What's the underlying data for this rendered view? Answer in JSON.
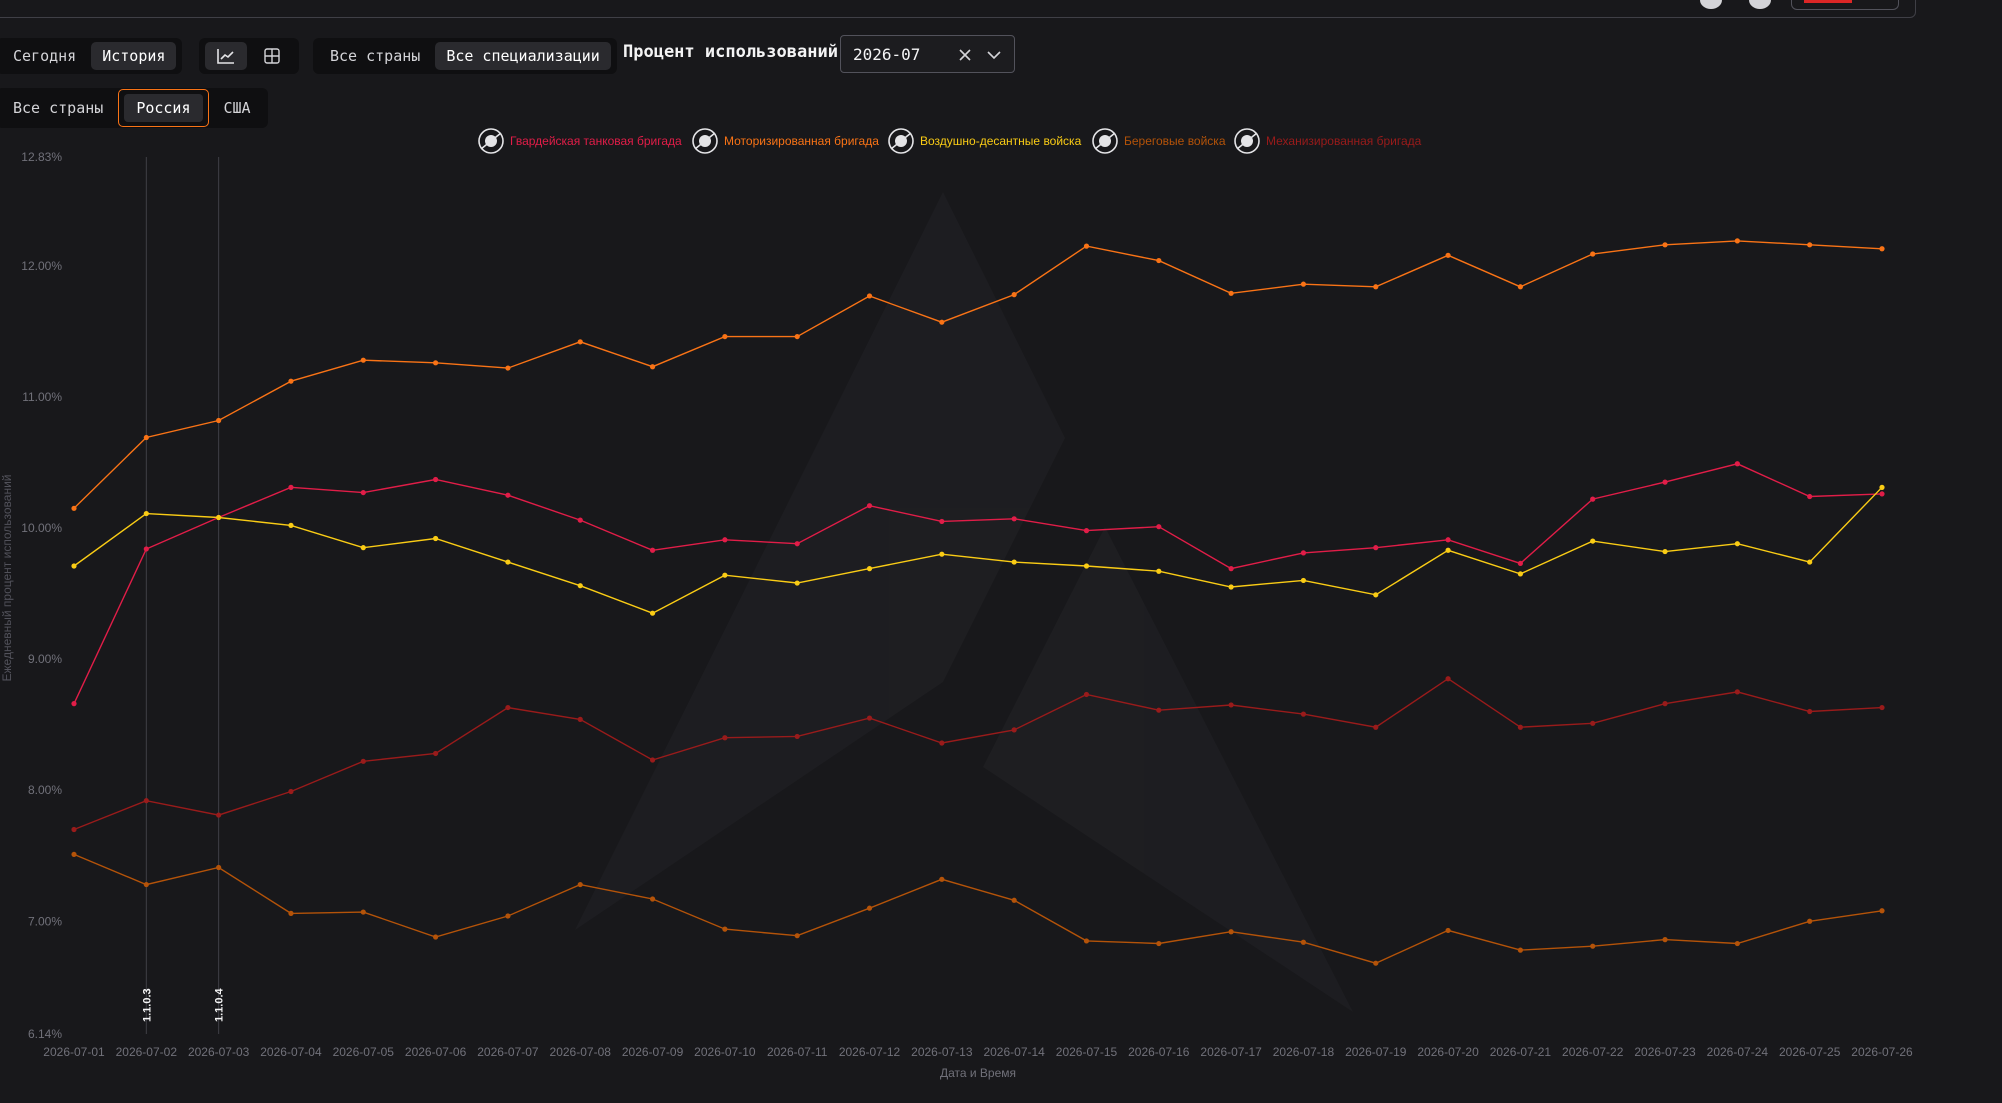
{
  "toolbar": {
    "range_tabs": [
      {
        "label": "Сегодня",
        "active": false
      },
      {
        "label": "История",
        "active": true
      }
    ],
    "view_icons": [
      {
        "icon": "line-chart-icon",
        "active": true
      },
      {
        "icon": "grid-table-icon",
        "active": false
      }
    ],
    "scope_tabs": [
      {
        "label": "Все страны",
        "active": false
      },
      {
        "label": "Все специализации",
        "active": true
      }
    ],
    "metric_label": "Процент использований",
    "month_value": "2026-07",
    "country_tabs": [
      {
        "label": "Все страны",
        "active": false
      },
      {
        "label": "Россия",
        "active": true
      },
      {
        "label": "США",
        "active": false
      }
    ]
  },
  "colors": {
    "background": "#18181b",
    "accent": "#f97316"
  },
  "chart_data": {
    "type": "line",
    "xlabel": "Дата и Время",
    "ylabel": "Ежедневный процент использований",
    "ylim": [
      6.14,
      12.83
    ],
    "y_ticks": [
      "12.83%",
      "12.00%",
      "11.00%",
      "10.00%",
      "9.00%",
      "8.00%",
      "7.00%",
      "6.14%"
    ],
    "y_tick_values": [
      12.83,
      12.0,
      11.0,
      10.0,
      9.0,
      8.0,
      7.0,
      6.14
    ],
    "legend_position": "top-center",
    "grid": false,
    "x": [
      "2026-07-01",
      "2026-07-02",
      "2026-07-03",
      "2026-07-04",
      "2026-07-05",
      "2026-07-06",
      "2026-07-07",
      "2026-07-08",
      "2026-07-09",
      "2026-07-10",
      "2026-07-11",
      "2026-07-12",
      "2026-07-13",
      "2026-07-14",
      "2026-07-15",
      "2026-07-16",
      "2026-07-17",
      "2026-07-18",
      "2026-07-19",
      "2026-07-20",
      "2026-07-21",
      "2026-07-22",
      "2026-07-23",
      "2026-07-24",
      "2026-07-25",
      "2026-07-26"
    ],
    "series": [
      {
        "name": "Гвардейская танковая бригада",
        "color": "#e11d48",
        "icon": "tank-brigade-emblem-icon",
        "values": [
          8.66,
          9.84,
          10.08,
          10.31,
          10.27,
          10.37,
          10.25,
          10.06,
          9.83,
          9.91,
          9.88,
          10.17,
          10.05,
          10.07,
          9.98,
          10.01,
          9.69,
          9.81,
          9.85,
          9.91,
          9.73,
          10.22,
          10.35,
          10.49,
          10.24,
          10.26
        ]
      },
      {
        "name": "Моторизированная бригада",
        "color": "#f97316",
        "icon": "motorized-brigade-emblem-icon",
        "values": [
          10.15,
          10.69,
          10.82,
          11.12,
          11.28,
          11.26,
          11.22,
          11.42,
          11.23,
          11.46,
          11.46,
          11.77,
          11.57,
          11.78,
          12.15,
          12.04,
          11.79,
          11.86,
          11.84,
          12.08,
          11.84,
          12.09,
          12.16,
          12.19,
          12.16,
          12.13
        ]
      },
      {
        "name": "Воздушно-десантные войска",
        "color": "#facc15",
        "icon": "paratrooper-emblem-icon",
        "values": [
          9.71,
          10.11,
          10.08,
          10.02,
          9.85,
          9.92,
          9.74,
          9.56,
          9.35,
          9.64,
          9.58,
          9.69,
          9.8,
          9.74,
          9.71,
          9.67,
          9.55,
          9.6,
          9.49,
          9.83,
          9.65,
          9.9,
          9.82,
          9.88,
          9.74,
          10.31
        ]
      },
      {
        "name": "Береговые войска",
        "color": "#b45309",
        "icon": "anchor-emblem-icon",
        "values": [
          7.51,
          7.28,
          7.41,
          7.06,
          7.07,
          6.88,
          7.04,
          7.28,
          7.17,
          6.94,
          6.89,
          7.1,
          7.32,
          7.16,
          6.85,
          6.83,
          6.92,
          6.84,
          6.68,
          6.93,
          6.78,
          6.81,
          6.86,
          6.83,
          7.0,
          7.08
        ]
      },
      {
        "name": "Механизированная бригада",
        "color": "#991b1b",
        "icon": "mechanized-brigade-emblem-icon",
        "values": [
          7.7,
          7.92,
          7.81,
          7.99,
          8.22,
          8.28,
          8.63,
          8.54,
          8.23,
          8.4,
          8.41,
          8.55,
          8.36,
          8.46,
          8.73,
          8.61,
          8.65,
          8.58,
          8.48,
          8.85,
          8.48,
          8.51,
          8.66,
          8.75,
          8.6,
          8.63
        ]
      }
    ],
    "annotations": [
      {
        "x": "2026-07-02",
        "label": "1.1.0.3"
      },
      {
        "x": "2026-07-03",
        "label": "1.1.0.4"
      }
    ]
  }
}
